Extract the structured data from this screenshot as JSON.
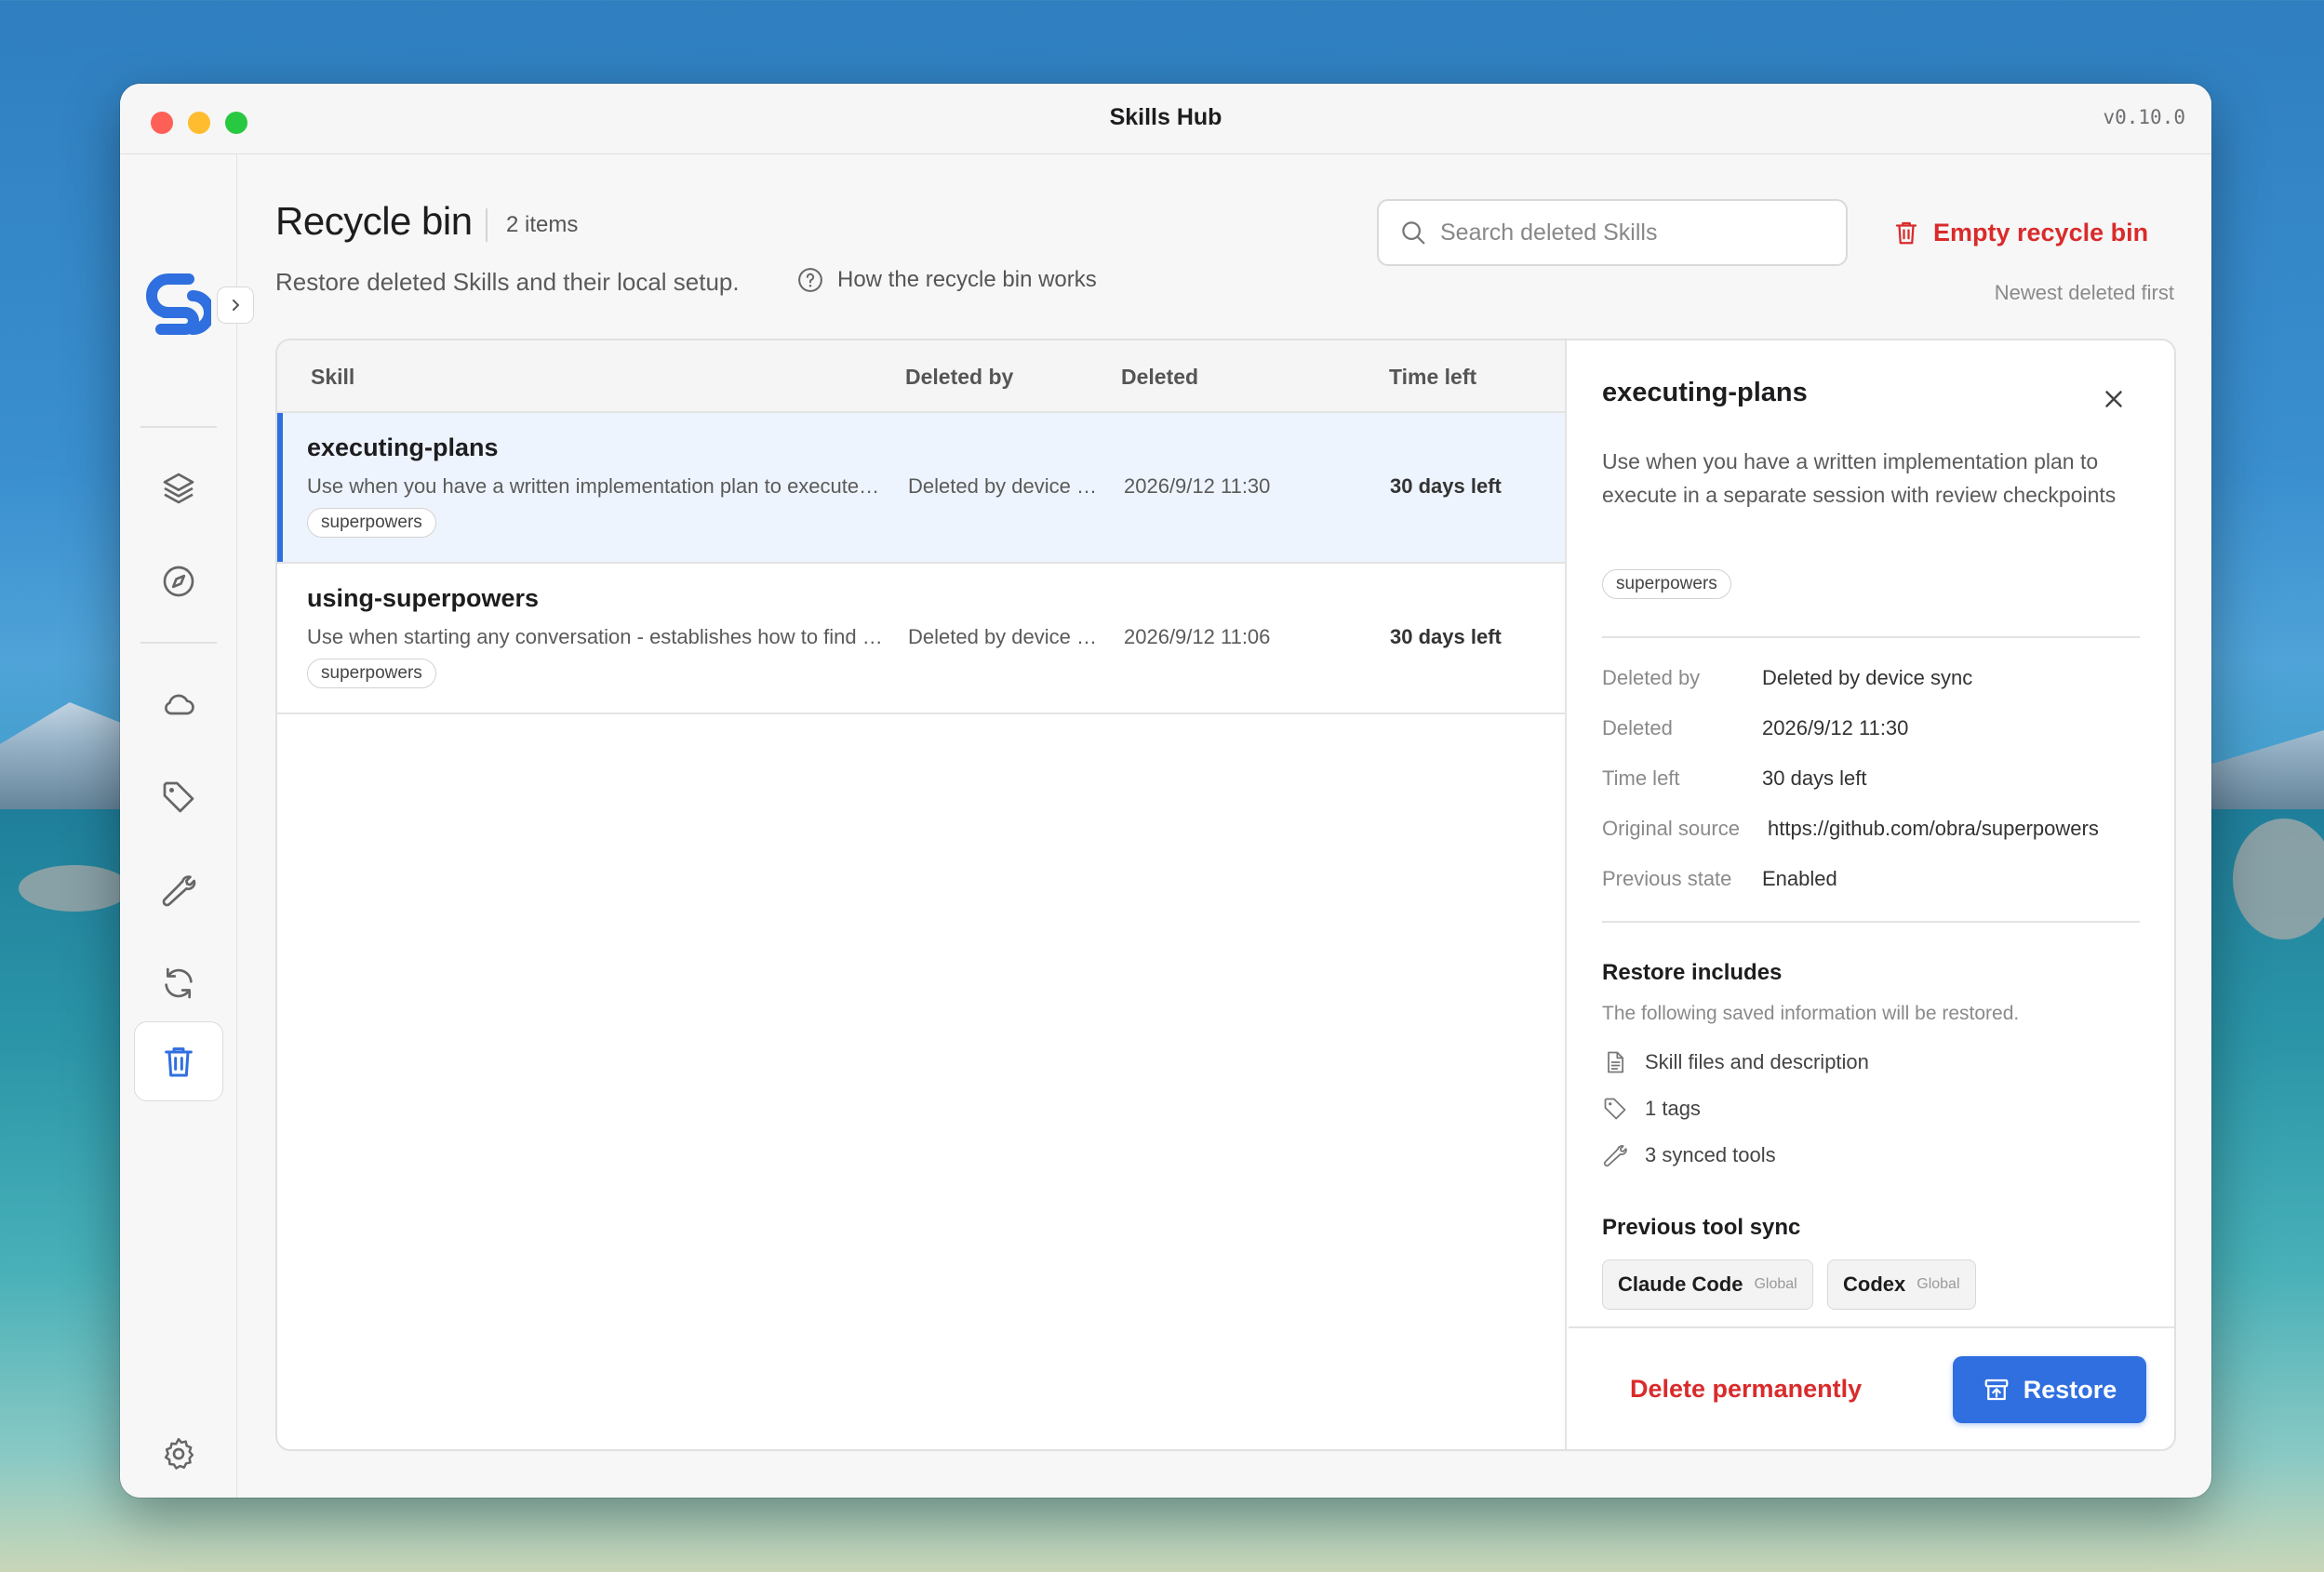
{
  "window": {
    "title": "Skills Hub",
    "version": "v0.10.0"
  },
  "sidebar": {
    "icons": [
      "layers-icon",
      "compass-icon",
      "cloud-icon",
      "tag-icon",
      "wrench-icon",
      "sync-icon",
      "trash-icon",
      "gear-icon"
    ],
    "active": "trash-icon",
    "accent": "#2f6fe0"
  },
  "header": {
    "title": "Recycle bin",
    "count": "2 items",
    "subtitle": "Restore deleted Skills and their local setup.",
    "help_link": "How the recycle bin works",
    "search_placeholder": "Search deleted Skills",
    "empty_button": "Empty recycle bin",
    "sort_label": "Newest deleted first"
  },
  "table": {
    "columns": [
      "Skill",
      "Deleted by",
      "Deleted",
      "Time left"
    ],
    "rows": [
      {
        "name": "executing-plans",
        "description": "Use when you have a written implementation plan to execute in a separate session with review checkpoints",
        "tag": "superpowers",
        "deleted_by": "Deleted by device sync",
        "deleted": "2026/9/12 11:30",
        "time_left": "30 days left",
        "selected": true
      },
      {
        "name": "using-superpowers",
        "description": "Use when starting any conversation - establishes how to find and use skills",
        "tag": "superpowers",
        "deleted_by": "Deleted by device sync",
        "deleted": "2026/9/12 11:06",
        "time_left": "30 days left",
        "selected": false
      }
    ]
  },
  "detail": {
    "title": "executing-plans",
    "description": "Use when you have a written implementation plan to execute in a separate session with review checkpoints",
    "tag": "superpowers",
    "fields": [
      {
        "label": "Deleted by",
        "value": "Deleted by device sync"
      },
      {
        "label": "Deleted",
        "value": "2026/9/12 11:30"
      },
      {
        "label": "Time left",
        "value": "30 days left"
      },
      {
        "label": "Original source",
        "value": "https://github.com/obra/superpowers"
      },
      {
        "label": "Previous state",
        "value": "Enabled"
      }
    ],
    "restore_heading": "Restore includes",
    "restore_note": "The following saved information will be restored.",
    "restore_items": [
      "Skill files and description",
      "1 tags",
      "3 synced tools"
    ],
    "tool_sync_heading": "Previous tool sync",
    "tools": [
      {
        "name": "Claude Code",
        "scope": "Global"
      },
      {
        "name": "Codex",
        "scope": "Global"
      }
    ],
    "delete_button": "Delete permanently",
    "restore_button": "Restore"
  }
}
